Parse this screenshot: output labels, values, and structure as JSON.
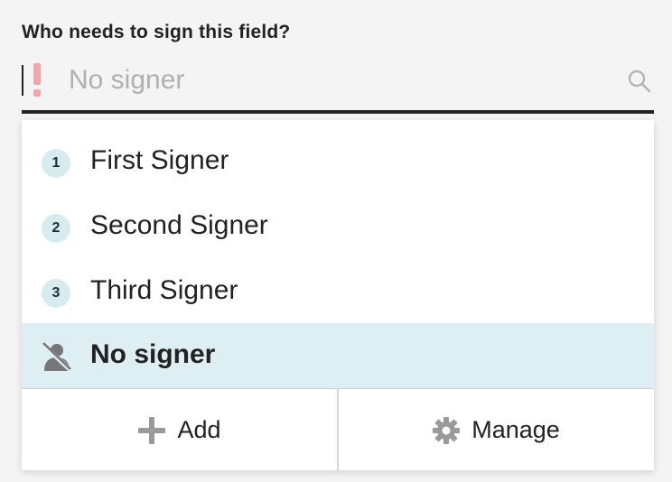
{
  "field": {
    "label": "Who needs to sign this field?",
    "placeholder": "No signer"
  },
  "options": [
    {
      "badge": "1",
      "label": "First Signer"
    },
    {
      "badge": "2",
      "label": "Second Signer"
    },
    {
      "badge": "3",
      "label": "Third Signer"
    },
    {
      "label": "No signer",
      "selected": true
    }
  ],
  "footer": {
    "add_label": "Add",
    "manage_label": "Manage"
  },
  "icons": {
    "warning": "exclamation-icon",
    "search": "search-icon",
    "no_signer": "no-signer-icon",
    "add": "plus-icon",
    "manage": "gear-icon"
  },
  "colors": {
    "warning": "#f4a6a6",
    "badge_bg": "#d6ecef",
    "selected_bg": "#deeff4"
  }
}
